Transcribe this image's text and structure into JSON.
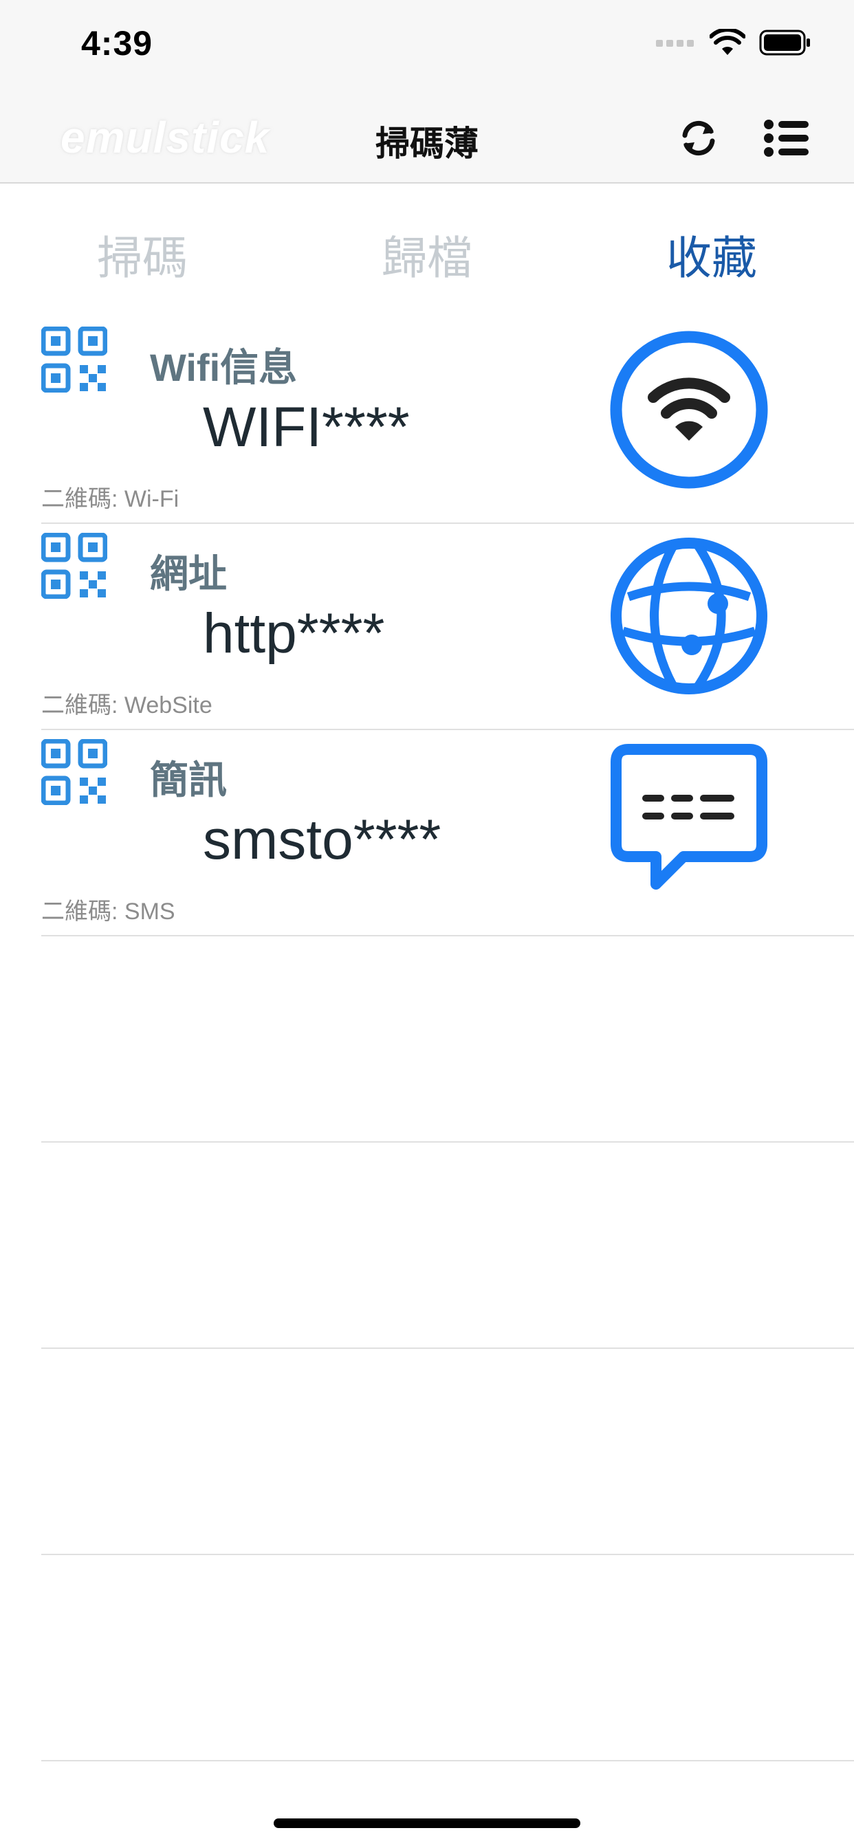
{
  "status_bar": {
    "time": "4:39"
  },
  "nav": {
    "brand": "emulstick",
    "title": "掃碼薄",
    "refresh_icon": "refresh-icon",
    "menu_icon": "list-menu-icon"
  },
  "tabs": [
    {
      "label": "掃碼",
      "active": false
    },
    {
      "label": "歸檔",
      "active": false
    },
    {
      "label": "收藏",
      "active": true
    }
  ],
  "rows": [
    {
      "title": "Wifi信息",
      "value": "WIFI****",
      "meta": "二維碼: Wi-Fi",
      "icon": "wifi-icon"
    },
    {
      "title": "網址",
      "value": "http****",
      "meta": "二維碼: WebSite",
      "icon": "globe-icon"
    },
    {
      "title": "簡訊",
      "value": "smsto****",
      "meta": "二維碼: SMS",
      "icon": "message-icon"
    }
  ],
  "colors": {
    "accent": "#1a7cf5",
    "tab_active": "#1a5aa8",
    "tab_inactive": "#c6ccd1",
    "qr_blue": "#2f8ee0"
  }
}
